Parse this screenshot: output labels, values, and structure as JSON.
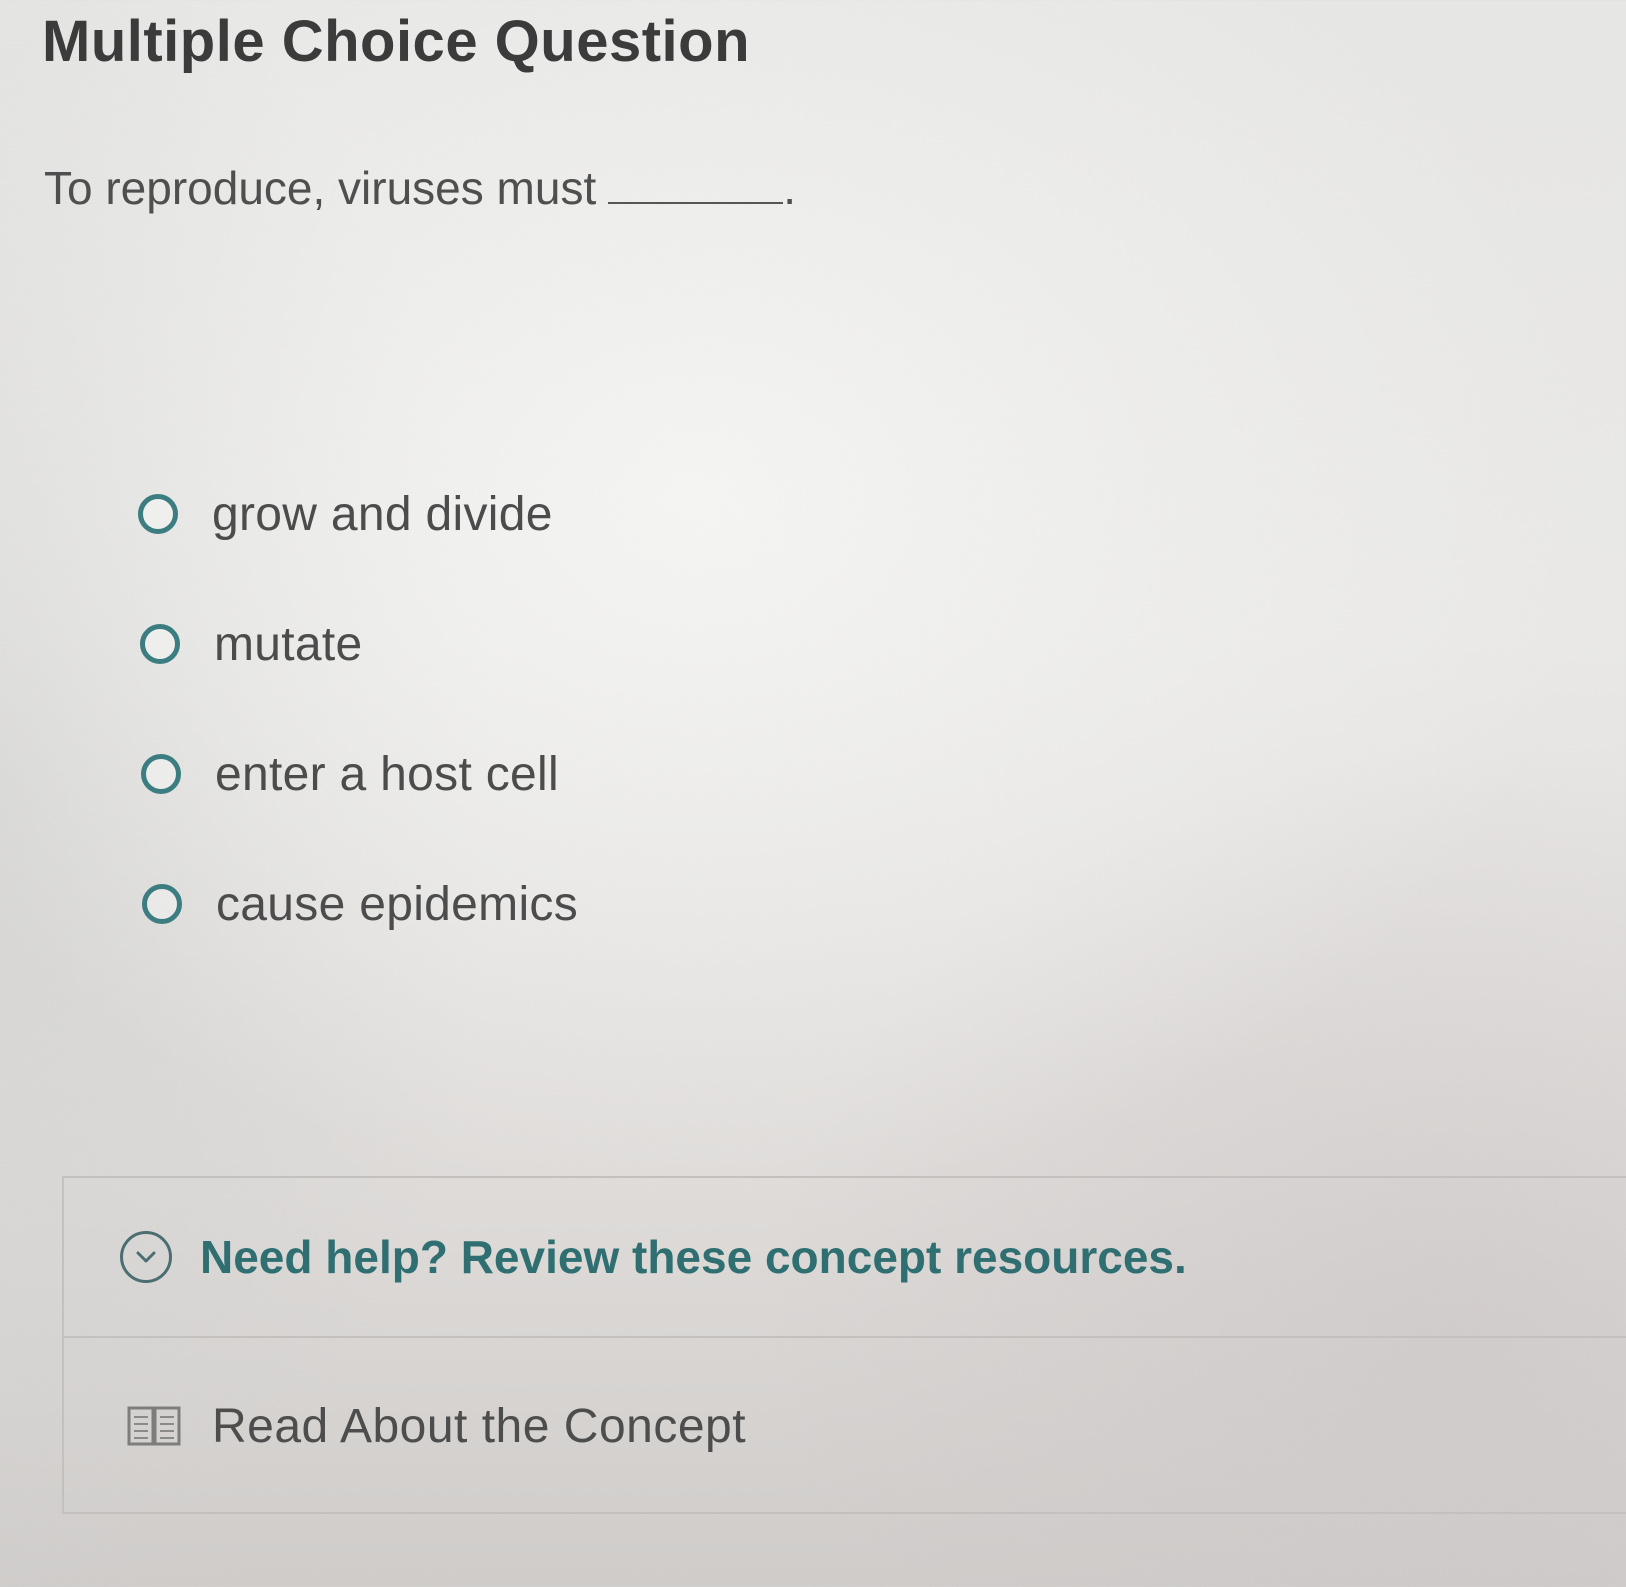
{
  "question": {
    "heading": "Multiple Choice Question",
    "prompt": "To reproduce, viruses must",
    "prompt_end": "."
  },
  "choices": [
    {
      "label": "grow and divide"
    },
    {
      "label": "mutate"
    },
    {
      "label": "enter a host cell"
    },
    {
      "label": "cause epidemics"
    }
  ],
  "help": {
    "title": "Need help? Review these concept resources.",
    "resources": [
      {
        "label": "Read About the Concept",
        "icon": "book-icon"
      }
    ]
  },
  "colors": {
    "accent": "#2f6f71",
    "radio_border": "#3b7d80"
  }
}
